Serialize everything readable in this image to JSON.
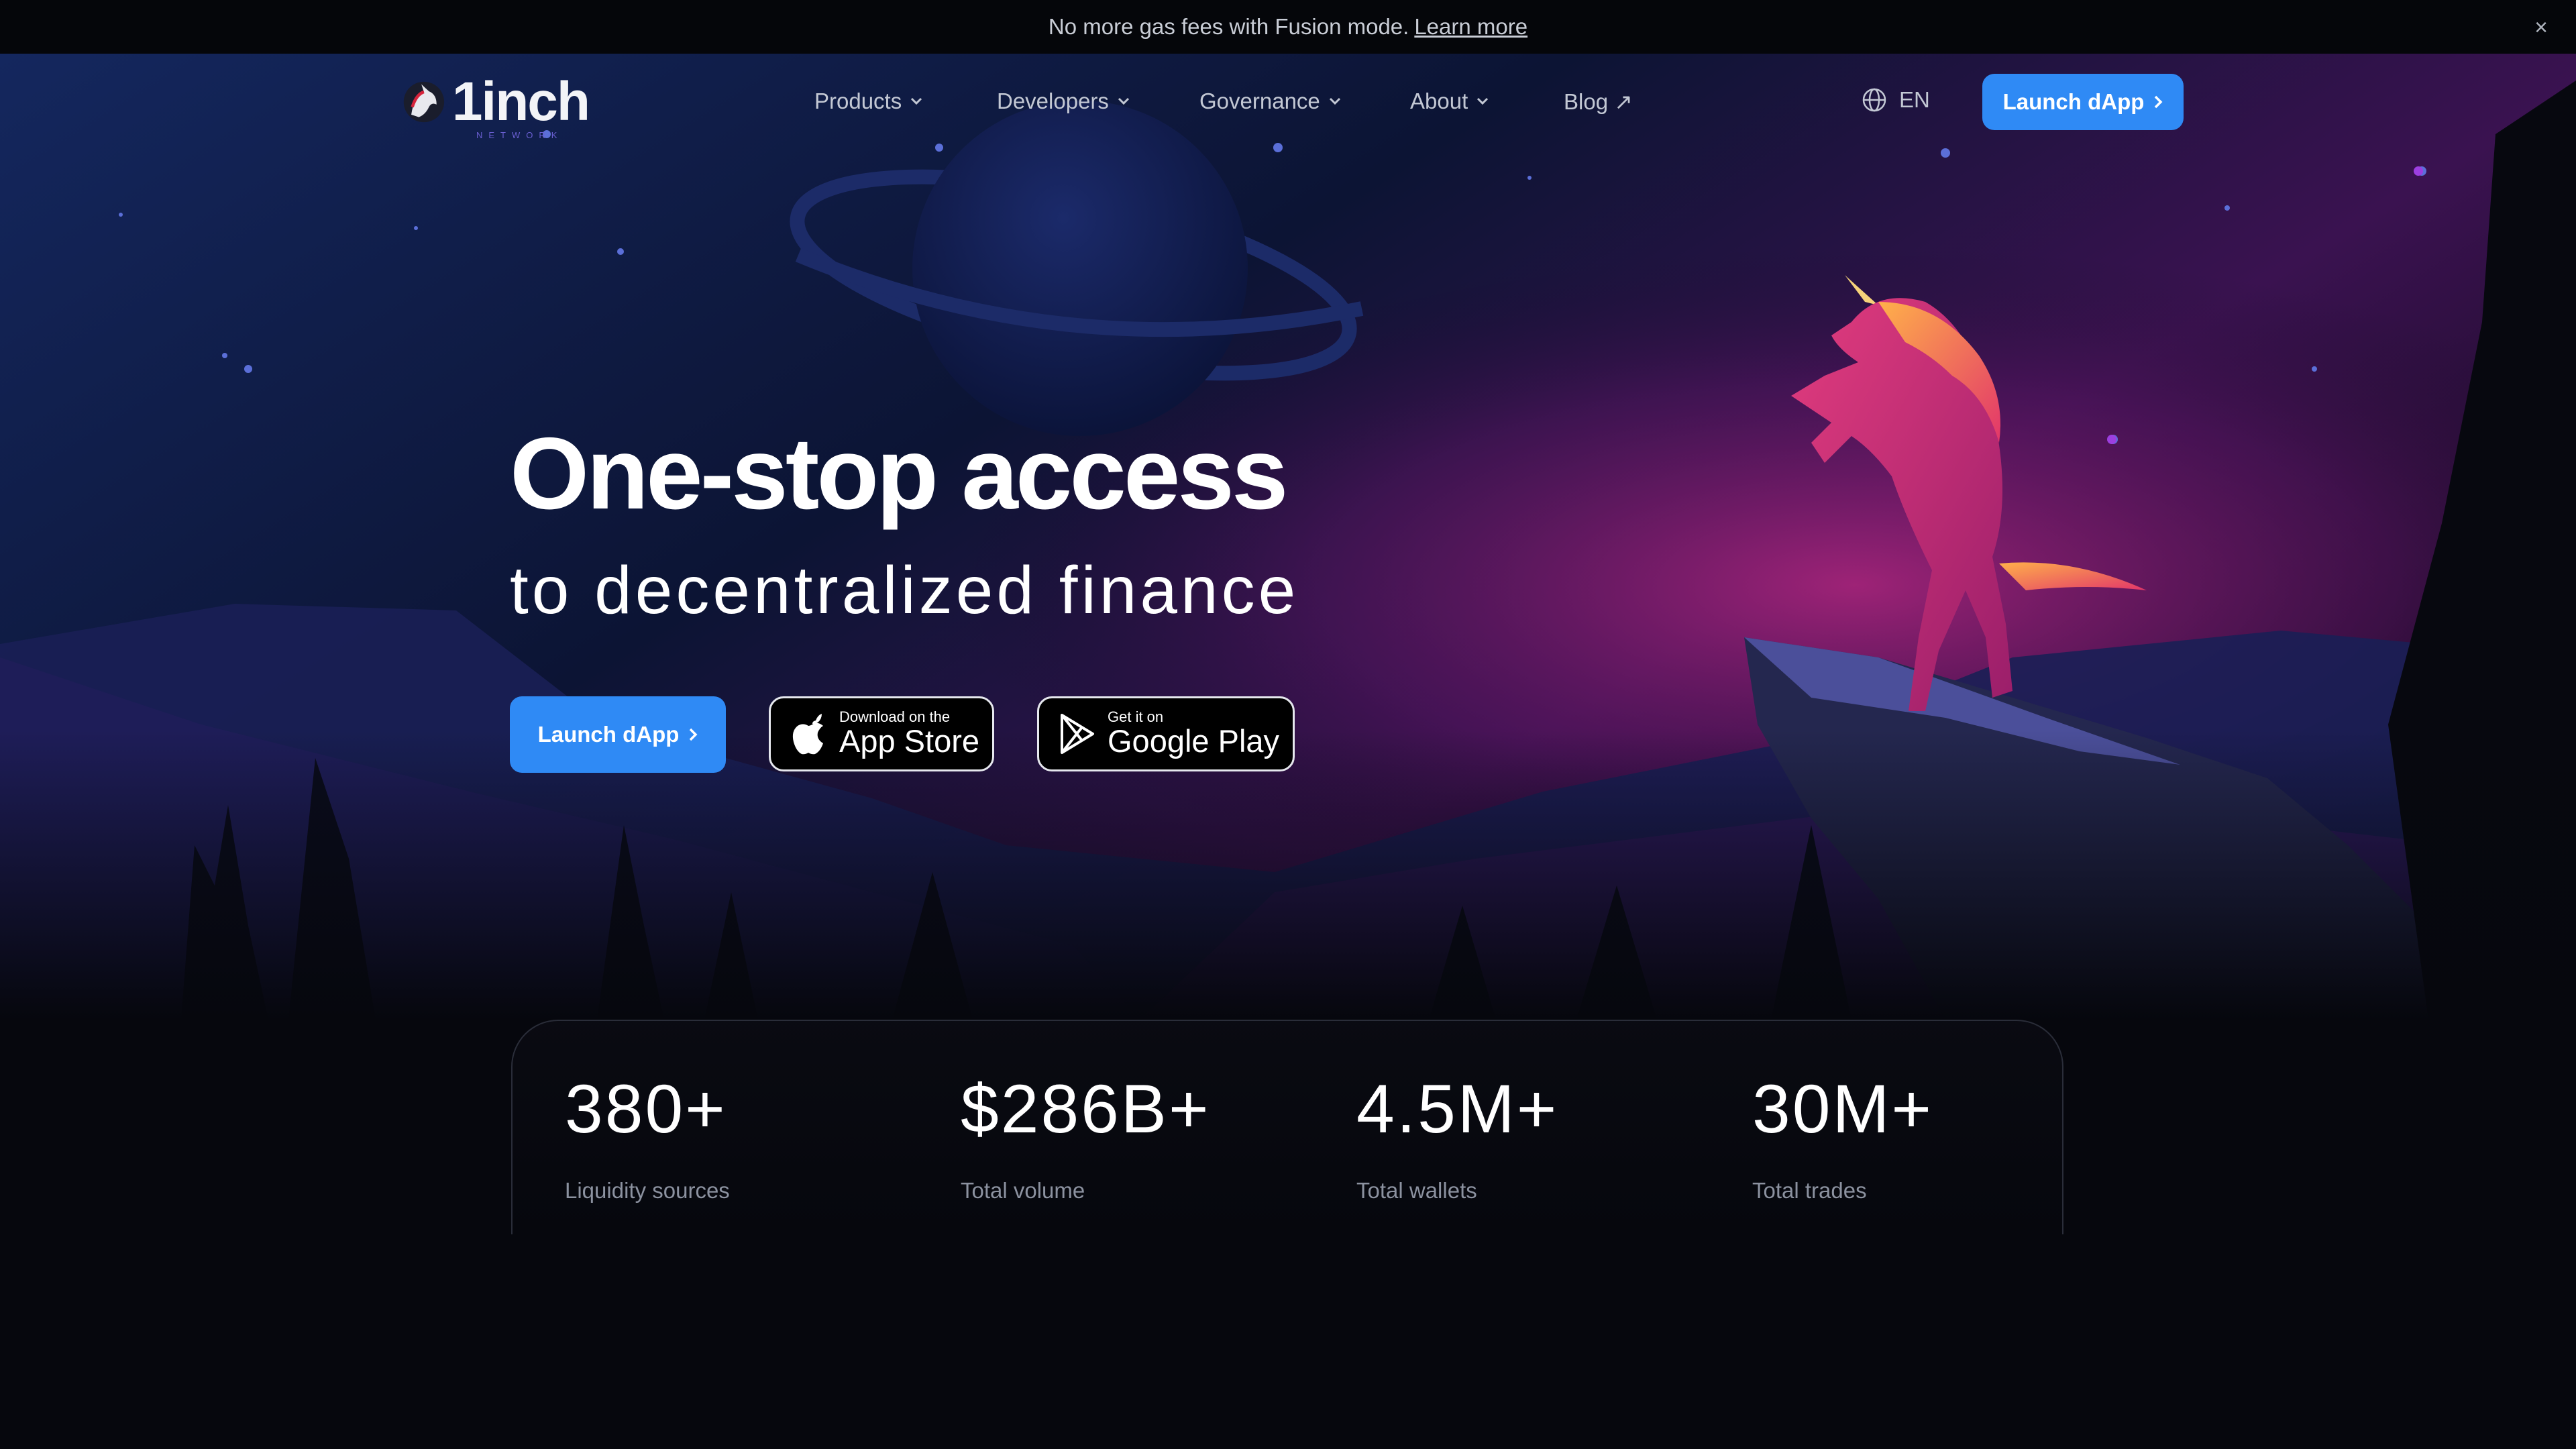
{
  "banner": {
    "text": "No more gas fees with Fusion mode.",
    "link": "Learn more",
    "close": "×"
  },
  "nav": {
    "logo": "1inch",
    "logo_sub": "NETWORK",
    "items": [
      {
        "label": "Products"
      },
      {
        "label": "Developers"
      },
      {
        "label": "Governance"
      },
      {
        "label": "About"
      },
      {
        "label": "Blog ↗"
      }
    ],
    "language": "EN",
    "launch": "Launch dApp"
  },
  "hero": {
    "title": "One-stop access",
    "subtitle": "to decentralized finance",
    "launch": "Launch dApp",
    "app_store": {
      "small": "Download on the",
      "big": "App Store"
    },
    "google_play": {
      "small": "Get it on",
      "big": "Google Play"
    }
  },
  "stats": [
    {
      "value": "380+",
      "label": "Liquidity sources"
    },
    {
      "value": "$286B+",
      "label": "Total volume"
    },
    {
      "value": "4.5M+",
      "label": "Total wallets"
    },
    {
      "value": "30M+",
      "label": "Total trades"
    }
  ],
  "colors": {
    "accent": "#2f8af5",
    "background": "#06070d",
    "sky_top": "#0f1c4a",
    "sky_glow": "#7a1f6a"
  },
  "icons": [
    "unicorn-logo-icon",
    "chevron-down-icon",
    "globe-icon",
    "chevron-right-icon",
    "apple-icon",
    "google-play-icon",
    "close-icon"
  ]
}
